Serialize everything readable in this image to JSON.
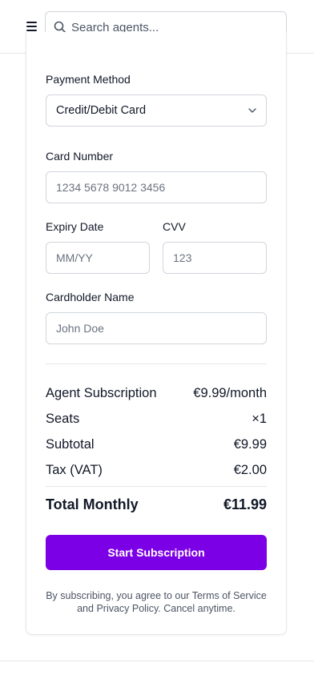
{
  "header": {
    "search": {
      "placeholder": "Search agents...",
      "value": ""
    }
  },
  "payment": {
    "method_label": "Payment Method",
    "method_value": "Credit/Debit Card",
    "card_number_label": "Card Number",
    "card_number_placeholder": "1234 5678 9012 3456",
    "expiry_label": "Expiry Date",
    "expiry_placeholder": "MM/YY",
    "cvv_label": "CVV",
    "cvv_placeholder": "123",
    "cardholder_label": "Cardholder Name",
    "cardholder_placeholder": "John Doe"
  },
  "summary": {
    "rows": [
      {
        "label": "Agent Subscription",
        "value": "€9.99/month"
      },
      {
        "label": "Seats",
        "value": "×1"
      },
      {
        "label": "Subtotal",
        "value": "€9.99"
      },
      {
        "label": "Tax (VAT)",
        "value": "€2.00"
      }
    ],
    "total_label": "Total Monthly",
    "total_value": "€11.99"
  },
  "cta": {
    "label": "Start Subscription"
  },
  "terms": "By subscribing, you agree to our Terms of Service and Privacy Policy. Cancel anytime.",
  "colors": {
    "accent": "#7c00e6",
    "border": "#d1d5db",
    "text": "#111827",
    "muted": "#4b5563"
  },
  "icons": {
    "menu": "hamburger-menu-icon",
    "search": "search-icon",
    "dropdown": "chevron-down-icon"
  }
}
